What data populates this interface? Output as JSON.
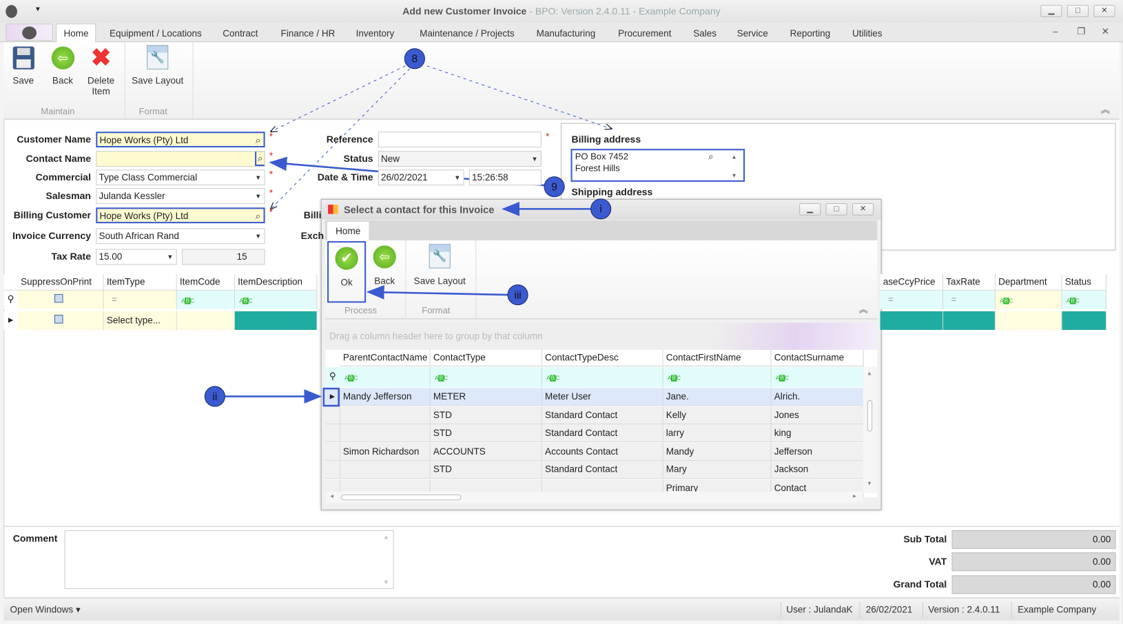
{
  "window": {
    "title": "Add new Customer Invoice",
    "subtitle": " - BPO: Version 2.4.0.11 - Example Company",
    "min": "▁",
    "max": "□",
    "close": "✕"
  },
  "menu": {
    "tabs": [
      "Home",
      "Equipment / Locations",
      "Contract",
      "Finance / HR",
      "Inventory",
      "Maintenance / Projects",
      "Manufacturing",
      "Procurement",
      "Sales",
      "Service",
      "Reporting",
      "Utilities"
    ]
  },
  "ribbon": {
    "save": "Save",
    "back": "Back",
    "delete": "Delete Item",
    "save_layout": "Save Layout",
    "group_maintain": "Maintain",
    "group_format": "Format"
  },
  "form": {
    "customer_name": {
      "label": "Customer Name",
      "value": "Hope Works (Pty) Ltd"
    },
    "contact_name": {
      "label": "Contact Name",
      "value": ""
    },
    "commercial": {
      "label": "Commercial",
      "value": "Type Class Commercial"
    },
    "salesman": {
      "label": "Salesman",
      "value": "Julanda Kessler"
    },
    "billing_customer": {
      "label": "Billing Customer",
      "value": "Hope Works (Pty) Ltd"
    },
    "invoice_currency": {
      "label": "Invoice Currency",
      "value": "South African Rand"
    },
    "tax_rate": {
      "label": "Tax Rate",
      "value": "15.00",
      "spin": "15"
    },
    "reference": {
      "label": "Reference",
      "value": ""
    },
    "status": {
      "label": "Status",
      "value": "New"
    },
    "date_time": {
      "label": "Date & Time",
      "date": "26/02/2021",
      "time": "15:26:58"
    },
    "billing_partial": "Billi",
    "exch_partial": "Exch",
    "billing_address": {
      "label": "Billing address",
      "line1": "PO Box 7452",
      "line2": "Forest Hills"
    },
    "shipping_address": {
      "label": "Shipping address"
    },
    "required_mark": "*"
  },
  "items_grid": {
    "columns_left": [
      "SuppressOnPrint",
      "ItemType",
      "ItemCode",
      "ItemDescription"
    ],
    "columns_right": [
      "aseCcyPrice",
      "TaxRate",
      "Department",
      "Status"
    ],
    "new_row_itemtype": "Select type..."
  },
  "dialog": {
    "title": "Select a contact for this Invoice",
    "tab": "Home",
    "ok": "Ok",
    "back": "Back",
    "save_layout": "Save Layout",
    "group_process": "Process",
    "group_format": "Format",
    "group_panel": "Drag a column header here to group by that column",
    "columns": [
      "ParentContactName",
      "ContactType",
      "ContactTypeDesc",
      "ContactFirstName",
      "ContactSurname"
    ],
    "rows": [
      [
        "Mandy Jefferson",
        "METER",
        "Meter User",
        "Jane.",
        "Alrich."
      ],
      [
        "",
        "STD",
        "Standard Contact",
        "Kelly",
        "Jones"
      ],
      [
        "",
        "STD",
        "Standard Contact",
        "larry",
        "king"
      ],
      [
        "Simon Richardson",
        "ACCOUNTS",
        "Accounts Contact",
        "Mandy",
        "Jefferson"
      ],
      [
        "",
        "STD",
        "Standard Contact",
        "Mary",
        "Jackson"
      ],
      [
        "",
        "",
        "",
        "Primary",
        "Contact"
      ]
    ]
  },
  "footer": {
    "comment_label": "Comment",
    "comment": "",
    "sub_total_label": "Sub Total",
    "sub_total": "0.00",
    "vat_label": "VAT",
    "vat": "0.00",
    "grand_total_label": "Grand Total",
    "grand_total": "0.00"
  },
  "statusbar": {
    "open_windows": "Open Windows ▾",
    "user": "User : JulandaK",
    "date": "26/02/2021",
    "version": "Version : 2.4.0.11",
    "company": "Example Company"
  },
  "annotations": {
    "n8": "8",
    "n9": "9",
    "i": "i",
    "ii": "ii",
    "iii": "iii",
    "color": "#3a5bd0"
  },
  "colors": {
    "accent": "#3a5bd0",
    "teal": "#20ada1",
    "required": "#dd2222",
    "lookup": "#fffbd0"
  }
}
